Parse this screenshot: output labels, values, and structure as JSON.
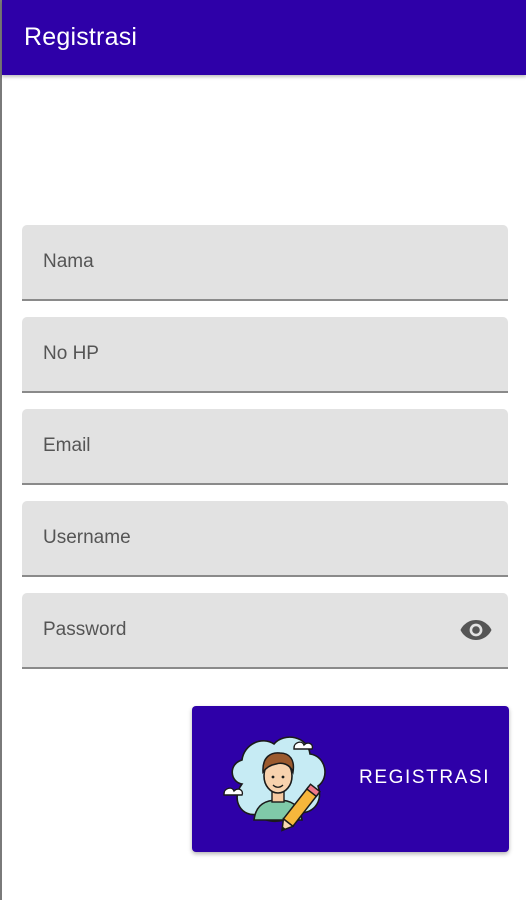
{
  "app_bar": {
    "title": "Registrasi"
  },
  "form": {
    "fields": [
      {
        "name": "nama",
        "placeholder": "Nama",
        "value": ""
      },
      {
        "name": "no_hp",
        "placeholder": "No HP",
        "value": ""
      },
      {
        "name": "email",
        "placeholder": "Email",
        "value": ""
      },
      {
        "name": "username",
        "placeholder": "Username",
        "value": ""
      },
      {
        "name": "password",
        "placeholder": "Password",
        "value": "",
        "trailing_icon": "eye-icon"
      }
    ]
  },
  "register_button": {
    "label": "REGISTRASI",
    "icon": "user-edit-illustration"
  },
  "colors": {
    "primary": "#2e00a8",
    "field_bg": "#e2e2e2",
    "field_underline": "#8a8a8a",
    "on_primary": "#ffffff"
  }
}
